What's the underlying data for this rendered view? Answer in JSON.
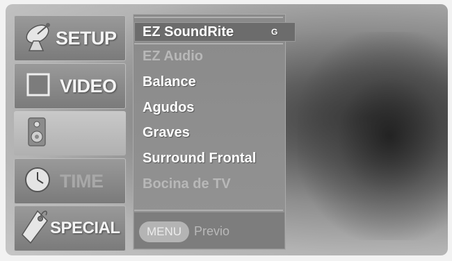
{
  "sidebar": {
    "items": [
      {
        "label": "SETUP",
        "icon": "satellite-dish-icon"
      },
      {
        "label": "VIDEO",
        "icon": "screen-icon"
      },
      {
        "label": "",
        "icon": "speaker-icon"
      },
      {
        "label": "TIME",
        "icon": "clock-icon"
      },
      {
        "label": "SPECIAL",
        "icon": "tag-icon"
      }
    ]
  },
  "menu": {
    "items": [
      {
        "label": "EZ SoundRite",
        "badge": "G"
      },
      {
        "label": "EZ Audio"
      },
      {
        "label": "Balance"
      },
      {
        "label": "Agudos"
      },
      {
        "label": "Graves"
      },
      {
        "label": "Surround Frontal"
      },
      {
        "label": "Bocina de TV"
      }
    ]
  },
  "footer": {
    "button_label": "MENU",
    "hint": "Previo"
  },
  "colors": {
    "panel": "#8a8a8a",
    "selection": "#6c6c6c",
    "text": "#ffffff"
  }
}
